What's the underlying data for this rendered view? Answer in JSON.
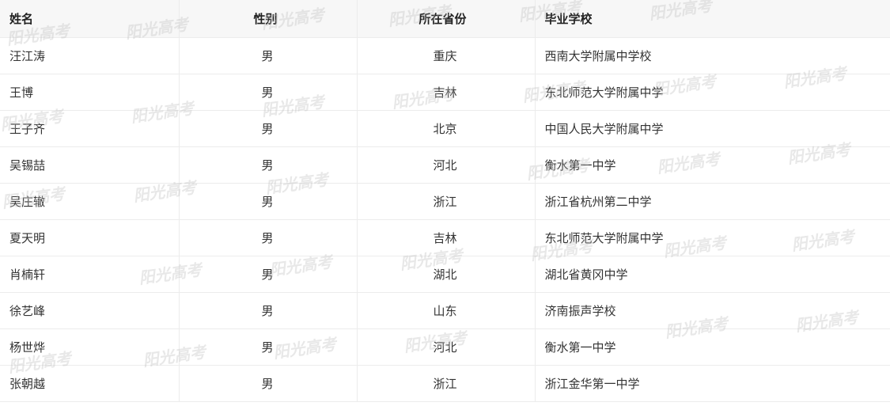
{
  "table": {
    "headers": [
      "姓名",
      "性别",
      "所在省份",
      "毕业学校"
    ],
    "rows": [
      {
        "name": "汪江涛",
        "gender": "男",
        "province": "重庆",
        "school": "西南大学附属中学校"
      },
      {
        "name": "王博",
        "gender": "男",
        "province": "吉林",
        "school": "东北师范大学附属中学"
      },
      {
        "name": "王子齐",
        "gender": "男",
        "province": "北京",
        "school": "中国人民大学附属中学"
      },
      {
        "name": "吴锡喆",
        "gender": "男",
        "province": "河北",
        "school": "衡水第一中学"
      },
      {
        "name": "吴庄辙",
        "gender": "男",
        "province": "浙江",
        "school": "浙江省杭州第二中学"
      },
      {
        "name": "夏天明",
        "gender": "男",
        "province": "吉林",
        "school": "东北师范大学附属中学"
      },
      {
        "name": "肖楠轩",
        "gender": "男",
        "province": "湖北",
        "school": "湖北省黄冈中学"
      },
      {
        "name": "徐艺峰",
        "gender": "男",
        "province": "山东",
        "school": "济南振声学校"
      },
      {
        "name": "杨世烨",
        "gender": "男",
        "province": "河北",
        "school": "衡水第一中学"
      },
      {
        "name": "张朝越",
        "gender": "男",
        "province": "浙江",
        "school": "浙江金华第一中学"
      }
    ]
  },
  "watermark": {
    "text": "阳光高考"
  }
}
